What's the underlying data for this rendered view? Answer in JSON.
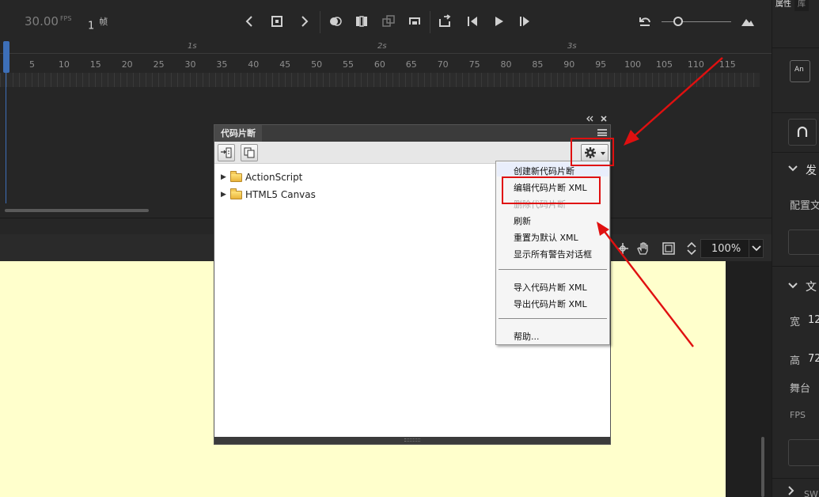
{
  "timeline": {
    "fps_value": "30.00",
    "fps_unit": "FPS",
    "current_frame": "1",
    "frame_unit": "帧",
    "seconds": [
      "1s",
      "2s",
      "3s"
    ],
    "frame_labels": [
      "5",
      "10",
      "15",
      "20",
      "25",
      "30",
      "35",
      "40",
      "45",
      "50",
      "55",
      "60",
      "65",
      "70",
      "75",
      "80",
      "85",
      "90",
      "95",
      "100",
      "105",
      "110",
      "115"
    ]
  },
  "stage": {
    "zoom": "100%"
  },
  "properties_panel": {
    "tab_active": "属性",
    "tab_inactive": "库",
    "icon_label": "An",
    "section_publish": "发",
    "config_label": "配置文",
    "section_doc": "文",
    "width_label": "宽",
    "width_value": "12",
    "height_label": "高",
    "height_value": "72",
    "stage_label": "舞台",
    "fps_label": "FPS",
    "section_swf": "SW"
  },
  "code_snippets": {
    "title": "代码片断",
    "tree": [
      {
        "label": "ActionScript"
      },
      {
        "label": "HTML5 Canvas"
      }
    ]
  },
  "context_menu": {
    "items": [
      {
        "label": "创建新代码片断",
        "enabled": true
      },
      {
        "label": "编辑代码片断 XML",
        "enabled": true
      },
      {
        "label": "删除代码片断",
        "enabled": false
      },
      {
        "label": "刷新",
        "enabled": true
      },
      {
        "label": "重置为默认 XML",
        "enabled": true
      },
      {
        "label": "显示所有警告对话框",
        "enabled": true
      },
      {
        "label": "导入代码片断 XML",
        "enabled": true
      },
      {
        "label": "导出代码片断 XML",
        "enabled": true
      },
      {
        "label": "帮助...",
        "enabled": true
      }
    ]
  },
  "colors": {
    "annotation": "#e01010",
    "stage": "#ffffcc",
    "playhead": "#3d6fb8"
  }
}
